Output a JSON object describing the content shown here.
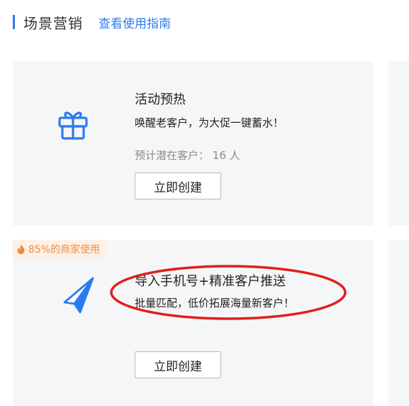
{
  "header": {
    "title": "场景营销",
    "guide_link": "查看使用指南"
  },
  "cards": [
    {
      "title": "活动预热",
      "description": "唤醒老客户，为大促一键蓄水！",
      "meta_label": "预计潜在客户：",
      "meta_value": "16 人",
      "button": "立即创建",
      "icon": "gift-icon"
    },
    {
      "badge": "85%的商家使用",
      "badge_icon": "flame-icon",
      "title": "导入手机号+精准客户推送",
      "description": "批量匹配，低价拓展海量新客户！",
      "button": "立即创建",
      "icon": "paper-plane-icon",
      "highlight": "red-ellipse"
    }
  ],
  "colors": {
    "accent": "#2b7bf0",
    "badge_text": "#f08d3a",
    "badge_bg": "#fdf0e6",
    "card_bg": "#f5f6f8",
    "highlight": "#e0201c"
  }
}
